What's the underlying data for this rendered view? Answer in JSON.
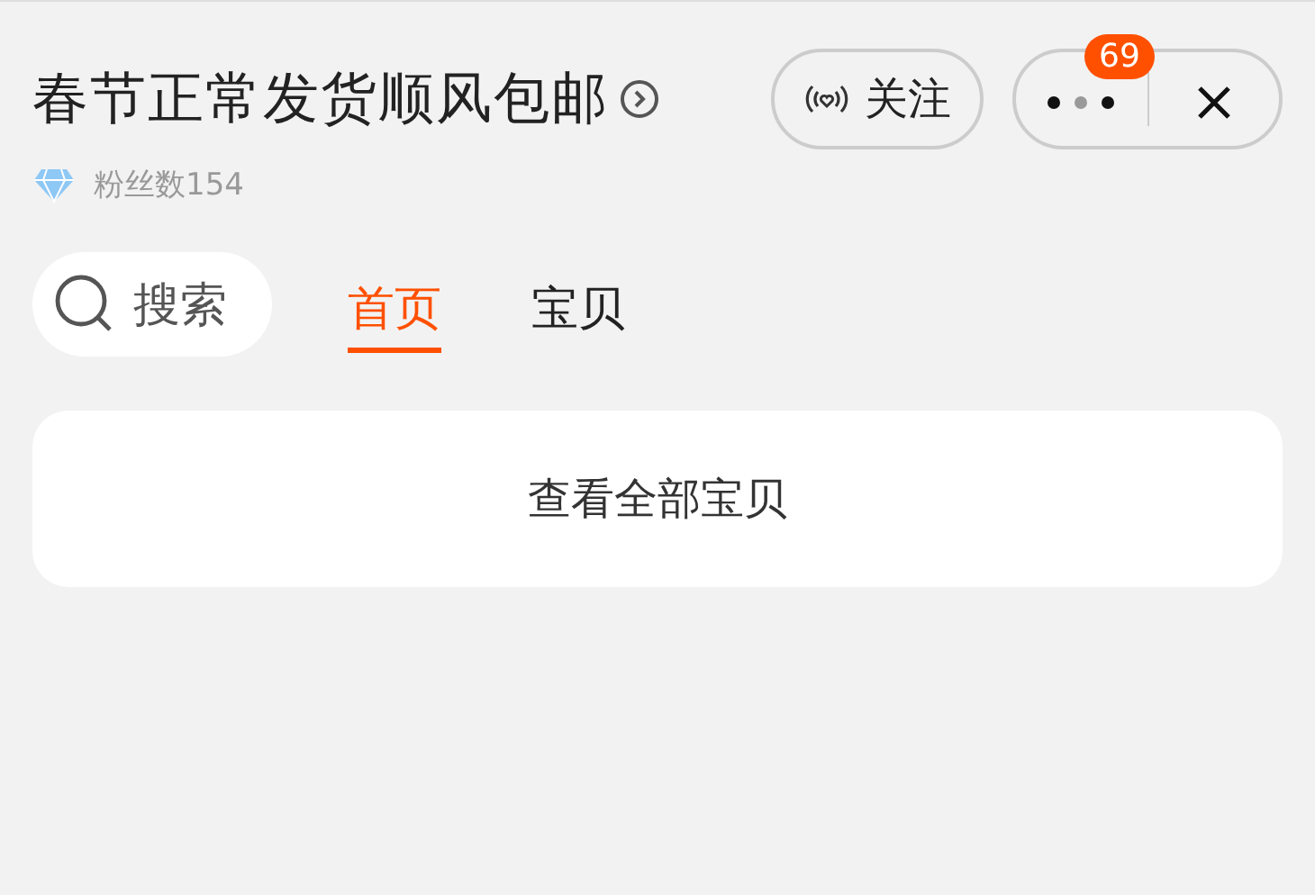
{
  "shop": {
    "title": "春节正常发货顺风包邮",
    "fans": "粉丝数154"
  },
  "follow": {
    "label": "关注"
  },
  "more": {
    "badge": "69"
  },
  "search": {
    "label": "搜索"
  },
  "tabs": [
    {
      "label": "首页",
      "selected": true
    },
    {
      "label": "宝贝",
      "selected": false
    }
  ],
  "card": {
    "label": "查看全部宝贝"
  }
}
